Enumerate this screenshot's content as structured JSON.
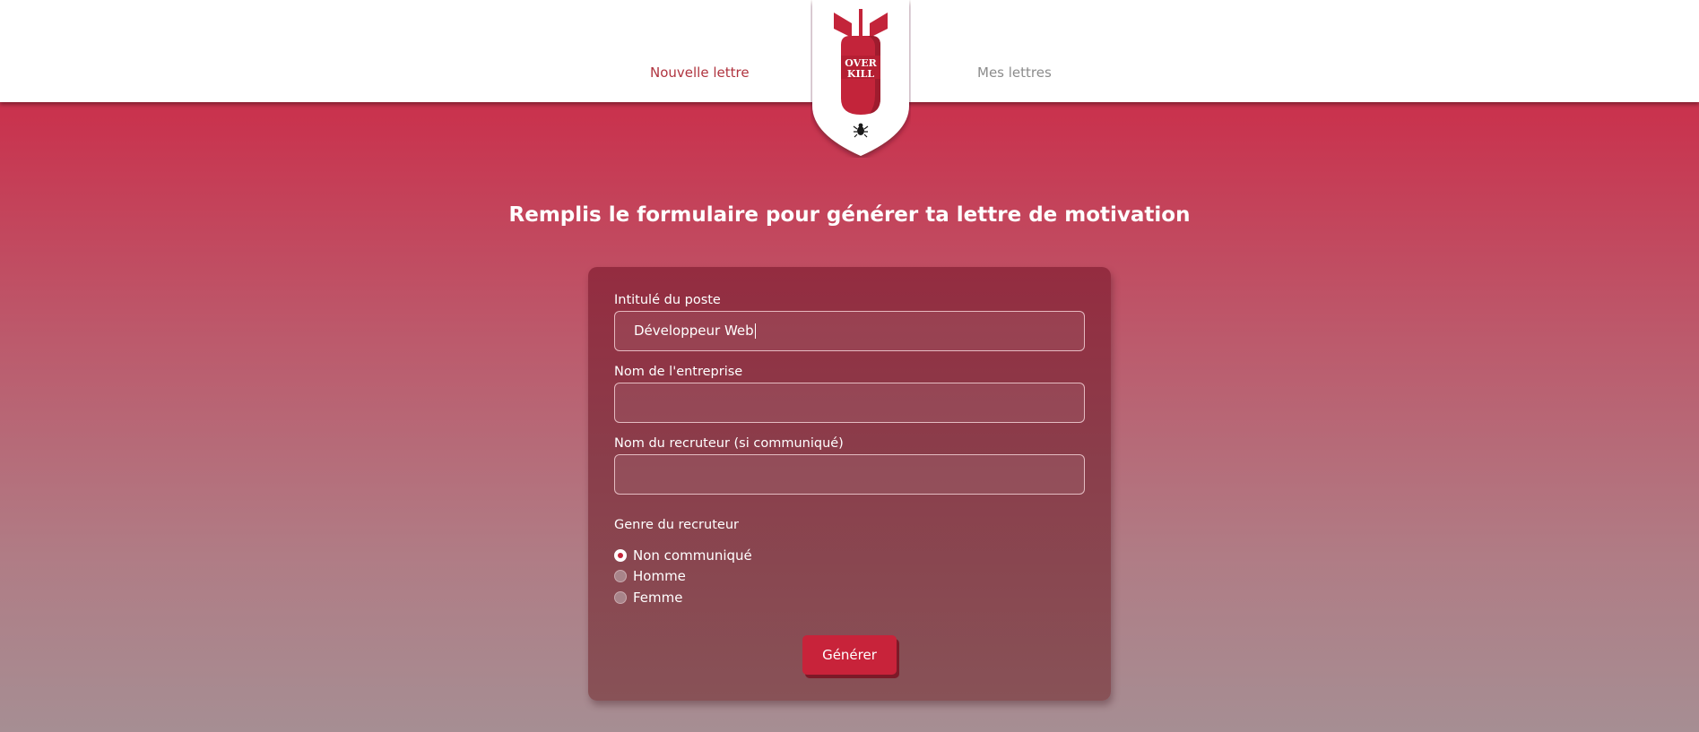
{
  "nav": {
    "new_letter": "Nouvelle lettre",
    "my_letters": "Mes lettres"
  },
  "logo": {
    "text_line1": "OVER",
    "text_line2": "KILL",
    "colors": {
      "bomb": "#c3243a",
      "shield": "#ffffff"
    }
  },
  "page": {
    "title": "Remplis le formulaire pour générer ta lettre de motivation"
  },
  "form": {
    "job_title": {
      "label": "Intitulé du poste",
      "value": "Développeur Web"
    },
    "company": {
      "label": "Nom de l'entreprise",
      "value": ""
    },
    "recruiter": {
      "label": "Nom du recruteur (si communiqué)",
      "value": ""
    },
    "gender": {
      "label": "Genre du recruteur",
      "options": [
        {
          "label": "Non communiqué",
          "checked": true
        },
        {
          "label": "Homme",
          "checked": false
        },
        {
          "label": "Femme",
          "checked": false
        }
      ]
    },
    "submit_label": "Générer"
  },
  "colors": {
    "accent": "#c8233a",
    "nav_active": "#b0343f",
    "nav_inactive": "#8c8c8c"
  }
}
